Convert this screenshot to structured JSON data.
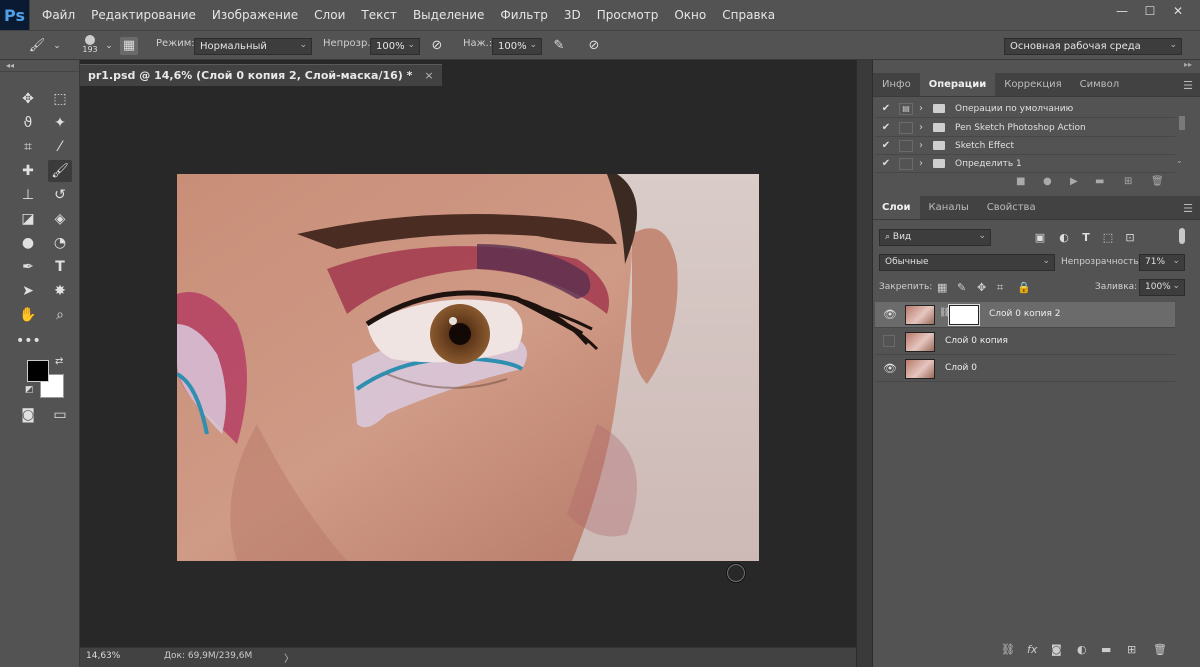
{
  "app": {
    "logo": "Ps"
  },
  "menu": {
    "items": [
      "Файл",
      "Редактирование",
      "Изображение",
      "Слои",
      "Текст",
      "Выделение",
      "Фильтр",
      "3D",
      "Просмотр",
      "Окно",
      "Справка"
    ]
  },
  "window": {
    "minimize": "—",
    "maximize": "☐",
    "close": "✕"
  },
  "options": {
    "brush_size": "193",
    "mode_label": "Режим:",
    "mode_value": "Нормальный",
    "opacity_label": "Непрозр.:",
    "opacity_value": "100%",
    "flow_label": "Наж.:",
    "flow_value": "100%",
    "workspace": "Основная рабочая среда"
  },
  "document": {
    "tab_title": "pr1.psd @ 14,6% (Слой 0 копия 2, Слой-маска/16) *",
    "close": "×"
  },
  "status": {
    "zoom": "14,63%",
    "doc": "Док: 69,9M/239,6M",
    "arrow": "〉"
  },
  "colors": {
    "foreground": "#000000",
    "background": "#ffffff"
  },
  "actions_panel": {
    "tabs": [
      "Инфо",
      "Операции",
      "Коррекция",
      "Символ"
    ],
    "active_tab": "Операции",
    "items": [
      {
        "label": "Операции по умолчанию",
        "checked": true,
        "has_dialog": true
      },
      {
        "label": "Pen Sketch Photoshop Action",
        "checked": true,
        "has_dialog": false
      },
      {
        "label": "Sketch Effect",
        "checked": true,
        "has_dialog": false
      },
      {
        "label": "Определить 1",
        "checked": true,
        "has_dialog": false
      }
    ],
    "buttons": [
      "stop-icon",
      "record-icon",
      "play-icon",
      "new-set-icon",
      "new-action-icon",
      "delete-icon"
    ]
  },
  "layers_panel": {
    "tabs": [
      "Слои",
      "Каналы",
      "Свойства"
    ],
    "active_tab": "Слои",
    "filter_label": "Вид",
    "blend_mode": "Обычные",
    "opacity_label": "Непрозрачность:",
    "opacity_value": "71%",
    "lock_label": "Закрепить:",
    "fill_label": "Заливка:",
    "fill_value": "100%",
    "layers": [
      {
        "name": "Слой 0 копия 2",
        "visible": true,
        "selected": true,
        "has_mask": true
      },
      {
        "name": "Слой 0 копия",
        "visible": false,
        "selected": false,
        "has_mask": false
      },
      {
        "name": "Слой 0",
        "visible": true,
        "selected": false,
        "has_mask": false
      }
    ],
    "bottom_buttons": [
      "link-layers-icon",
      "fx-icon",
      "add-mask-icon",
      "adjustment-icon",
      "group-icon",
      "new-layer-icon",
      "trash-icon"
    ]
  }
}
